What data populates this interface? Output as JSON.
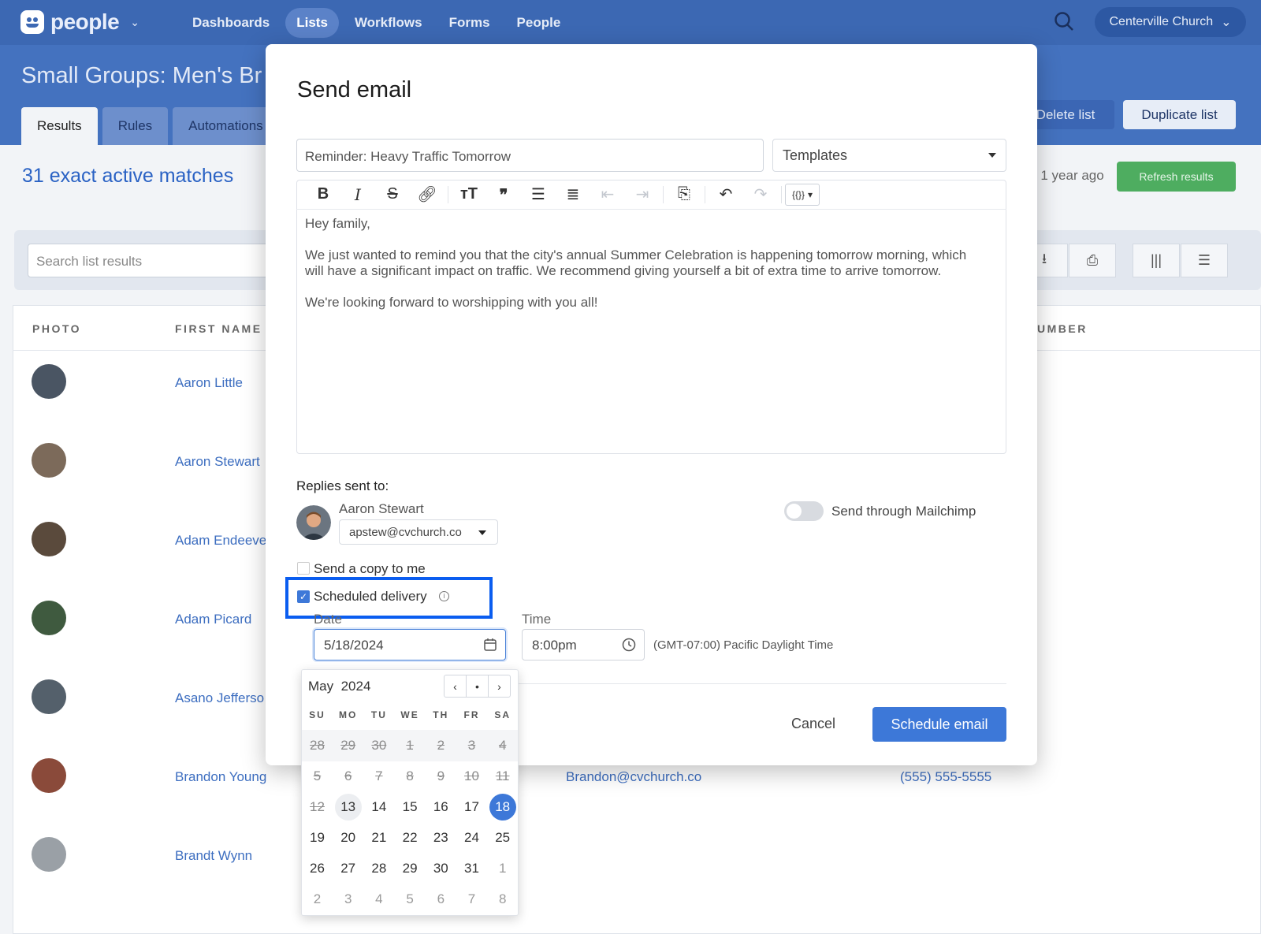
{
  "nav": {
    "logo_text": "people",
    "links": [
      "Dashboards",
      "Lists",
      "Workflows",
      "Forms",
      "People"
    ],
    "active_link": "Lists",
    "org": "Centerville Church"
  },
  "page": {
    "title": "Small Groups: Men's Br",
    "tabs": [
      "Results",
      "Rules",
      "Automations"
    ],
    "delete_label": "Delete list",
    "duplicate_label": "Duplicate list",
    "matches": "31 exact active matches",
    "updated": "r 1 year ago",
    "refresh_label": "Refresh results",
    "search_placeholder": "Search list results"
  },
  "table": {
    "headers": [
      "PHOTO",
      "FIRST NAME",
      "UMBER"
    ],
    "rows": [
      {
        "name": "Aaron Little",
        "email": "",
        "phone": ""
      },
      {
        "name": "Aaron Stewart",
        "email": "",
        "phone": ""
      },
      {
        "name": "Adam Endeeve",
        "email": "",
        "phone": ""
      },
      {
        "name": "Adam Picard",
        "email": "",
        "phone": ""
      },
      {
        "name": "Asano Jefferso",
        "email": "",
        "phone": ""
      },
      {
        "name": "Brandon Young",
        "email": "Brandon@cvchurch.co",
        "phone": "(555) 555-5555"
      },
      {
        "name": "Brandt Wynn",
        "email": "",
        "phone": ""
      }
    ]
  },
  "modal": {
    "title": "Send email",
    "subject": "Reminder: Heavy Traffic Tomorrow",
    "templates_label": "Templates",
    "body": [
      "Hey family,",
      "We just wanted to remind you that the city's annual Summer Celebration is happening tomorrow morning, which will have a significant impact on traffic. We recommend giving yourself a bit of extra time to arrive tomorrow.",
      "We're looking forward to worshipping with you all!"
    ],
    "replies_label": "Replies sent to:",
    "reply_name": "Aaron Stewart",
    "reply_email": "apstew@cvchurch.co",
    "mailchimp_label": "Send through Mailchimp",
    "mailchimp_on": false,
    "copy_label": "Send a copy to me",
    "copy_checked": false,
    "scheduled_label": "Scheduled delivery",
    "scheduled_checked": true,
    "date_label": "Date",
    "date_value": "5/18/2024",
    "time_label": "Time",
    "time_value": "8:00pm",
    "timezone": "(GMT-07:00) Pacific Daylight Time",
    "cancel_label": "Cancel",
    "schedule_label": "Schedule email"
  },
  "calendar": {
    "month": "May",
    "year": "2024",
    "dow": [
      "SU",
      "MO",
      "TU",
      "WE",
      "TH",
      "FR",
      "SA"
    ],
    "weeks": [
      [
        "28",
        "29",
        "30",
        "1",
        "2",
        "3",
        "4"
      ],
      [
        "5",
        "6",
        "7",
        "8",
        "9",
        "10",
        "11"
      ],
      [
        "12",
        "13",
        "14",
        "15",
        "16",
        "17",
        "18"
      ],
      [
        "19",
        "20",
        "21",
        "22",
        "23",
        "24",
        "25"
      ],
      [
        "26",
        "27",
        "28",
        "29",
        "30",
        "31",
        "1"
      ],
      [
        "2",
        "3",
        "4",
        "5",
        "6",
        "7",
        "8"
      ]
    ],
    "past_through": "12",
    "today": "13",
    "selected": "18"
  },
  "colors": {
    "brand": "#3c68b3",
    "accent": "#3d78d8",
    "success": "#4ead60",
    "highlight": "#0a5df0"
  }
}
